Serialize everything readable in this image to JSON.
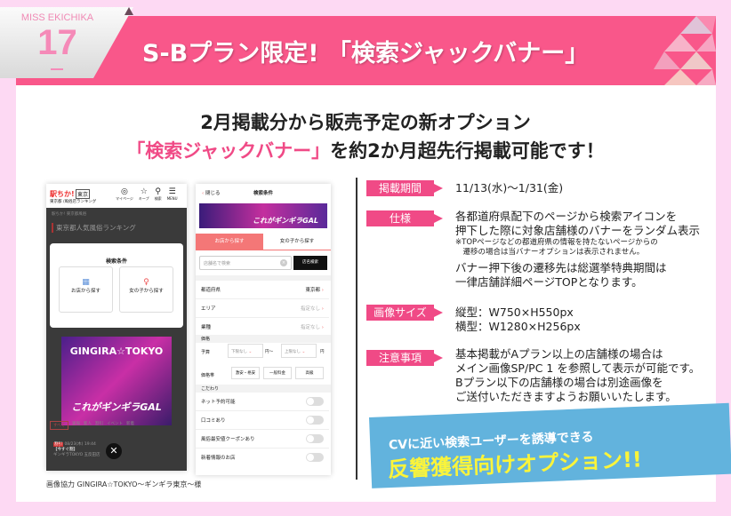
{
  "header": {
    "brand": "MISS EKICHIKA",
    "page_number": "17",
    "title": "S-Bプラン限定! 「検索ジャックバナー」",
    "accent": "#f9578a",
    "background": "#fdd9f3"
  },
  "lead": {
    "line1": "2月掲載分から販売予定の新オプション",
    "line2_highlight": "「検索ジャックバナー」",
    "line2_rest": "を約2か月超先行掲載可能です！"
  },
  "phone_left": {
    "logo": "駅ちか!",
    "area_badge": "東京",
    "subtitle": "東京都 /風俗店ランキング",
    "nav": [
      "マイページ",
      "キープ",
      "検索",
      "MENU"
    ],
    "breadcrumb": "駅ちか! 東京都風俗",
    "page_heading": "東京都人気風俗ランキング",
    "dialog_title": "検索条件",
    "dialog_shop": "お店から探す",
    "dialog_girl": "女の子から探す",
    "banner_title": "GINGIRA☆TOKYO",
    "banner_slogan": "これがギンギラGAL",
    "filters": [
      "すべて",
      "速報",
      "新人",
      "割引",
      "イベント",
      "新着"
    ],
    "news_badge": "割引",
    "news_date": "08/23(木) 19:44",
    "news_title": "【今すぐ割】",
    "news_sub": "ギンギラTOKYO 五反田店"
  },
  "phone_right": {
    "close": "閉じる",
    "title": "検索条件",
    "banner_slogan": "これがギンギラGAL",
    "tab_shop": "お店から探す",
    "tab_girl": "女の子から探す",
    "search_placeholder": "店舗名で検索",
    "search_button": "店名検索",
    "rows": [
      {
        "label": "都道府県",
        "value": "東京都"
      },
      {
        "label": "エリア",
        "value": "指定なし"
      },
      {
        "label": "業種",
        "value": "指定なし"
      }
    ],
    "price_section": "価格",
    "budget_label": "予算",
    "budget_min": "下限なし",
    "yen_range": "円〜",
    "budget_max": "上限なし",
    "yen": "円",
    "price_type_label": "価格帯",
    "price_types": [
      "激安・格安",
      "一般料金",
      "高級"
    ],
    "kodawari": "こだわり",
    "toggles": [
      "ネット予約可能",
      "口コミあり",
      "風俗最安値クーポンあり",
      "新着情報のお店"
    ]
  },
  "details": [
    {
      "tag": "掲載期間",
      "lines": [
        "11/13(水)〜1/31(金)"
      ]
    },
    {
      "tag": "仕様",
      "lines": [
        "各都道府県配下のページから検索アイコンを",
        "押下した際に対象店舗様のバナーをランダム表示"
      ],
      "note": [
        "※TOPページなどの都道府県の情報を持たないページからの",
        "　遷移の場合は当バナーオプションは表示されません。"
      ],
      "lines2": [
        "バナー押下後の遷移先は総選挙特典期間は",
        "一律店舗詳細ページTOPとなります。"
      ]
    },
    {
      "tag": "画像サイズ",
      "lines": [
        "縦型：W750×H550px",
        "横型：W1280×H256px"
      ]
    },
    {
      "tag": "注意事項",
      "lines": [
        "基本掲載がAプラン以上の店舗様の場合は",
        "メイン画像SP/PC 1 を参照して表示が可能です。",
        "Bプラン以下の店舗様の場合は別途画像を",
        "ご送付いただきますようお願いいたします。"
      ]
    }
  ],
  "callout": {
    "line1": "CVに近い検索ユーザーを誘導できる",
    "line2": "反響獲得向けオプション!!",
    "color": "#62b3dd"
  },
  "credit": "画像協力 GINGIRA☆TOKYO〜ギンギラ東京〜様"
}
